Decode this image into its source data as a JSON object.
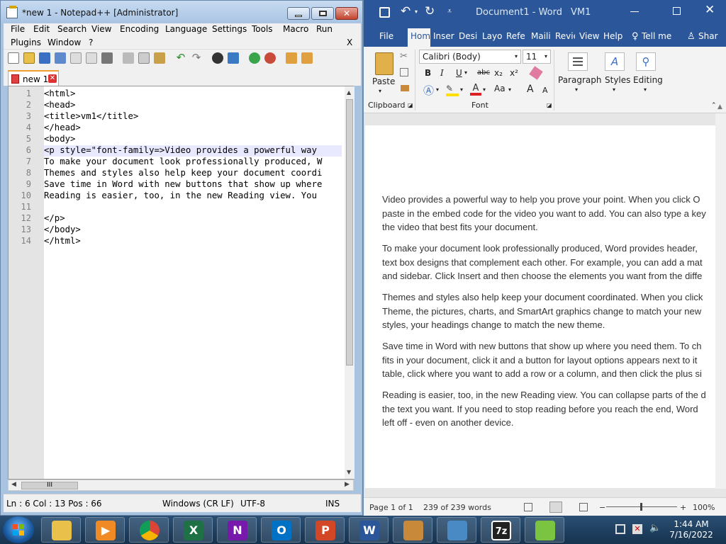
{
  "notepad": {
    "title": "*new 1 - Notepad++ [Administrator]",
    "menu": [
      "File",
      "Edit",
      "Search",
      "View",
      "Encoding",
      "Language",
      "Settings",
      "Tools",
      "Macro",
      "Run",
      "Plugins",
      "Window",
      "?"
    ],
    "menu_close": "X",
    "tab_label": "new 1",
    "lines": [
      {
        "n": "1",
        "text": "<html>"
      },
      {
        "n": "2",
        "text": "<head>"
      },
      {
        "n": "3",
        "text": "<title>vm1</title>"
      },
      {
        "n": "4",
        "text": "</head>"
      },
      {
        "n": "5",
        "text": "<body>"
      },
      {
        "n": "6",
        "text": "<p style=\"font-family=>Video provides a powerful way"
      },
      {
        "n": "7",
        "text": "To make your document look professionally produced, W"
      },
      {
        "n": "8",
        "text": "Themes and styles also help keep your document coordi"
      },
      {
        "n": "9",
        "text": "Save time in Word with new buttons that show up where"
      },
      {
        "n": "10",
        "text": "Reading is easier, too, in the new Reading view. You"
      },
      {
        "n": "11",
        "text": ""
      },
      {
        "n": "12",
        "text": "</p>"
      },
      {
        "n": "13",
        "text": "</body>"
      },
      {
        "n": "14",
        "text": "</html>"
      }
    ],
    "hscroll_thumb": "III",
    "status": {
      "pos": "Ln : 6    Col : 13    Pos : 66",
      "eol": "Windows (CR LF)",
      "enc": "UTF-8",
      "mode": "INS"
    }
  },
  "word": {
    "doc_title": "Document1  -  Word",
    "vm": "VM1",
    "tabs": [
      "File",
      "Hom",
      "Inser",
      "Desig",
      "Layo",
      "Refe",
      "Maili",
      "Revie",
      "View",
      "Help",
      "Tell me",
      "Shar"
    ],
    "font_name": "Calibri (Body)",
    "font_size": "11",
    "paste_label": "Paste",
    "clipboard_label": "Clipboard",
    "font_label": "Font",
    "paragraph_label": "Paragraph",
    "styles_label": "Styles",
    "editing_label": "Editing",
    "fmt": {
      "b": "B",
      "i": "I",
      "u": "U",
      "strike": "abc",
      "sub": "x₂",
      "sup": "x²",
      "case": "Aa",
      "grow": "A",
      "shrink": "A"
    },
    "paragraphs": [
      [
        "Video provides a powerful way to help you prove your point. When you click O",
        "paste in the embed code for the video you want to add. You can also type a key",
        "the video that best fits your document."
      ],
      [
        "To make your document look professionally produced, Word provides header,",
        "text box designs that complement each other. For example, you can add a mat",
        "and sidebar. Click Insert and then choose the elements you want from the diffe"
      ],
      [
        "Themes and styles also help keep your document coordinated. When you click",
        "Theme, the pictures, charts, and SmartArt graphics change to match your new",
        "styles, your headings change to match the new theme."
      ],
      [
        "Save time in Word with new buttons that show up where you need them. To ch",
        "fits in your document, click it and a button for layout options appears next to it",
        "table, click where you want to add a row or a column, and then click the plus si"
      ],
      [
        "Reading is easier, too, in the new Reading view. You can collapse parts of the d",
        "the text you want. If you need to stop reading before you reach the end, Word",
        "left off - even on another device."
      ]
    ],
    "status": {
      "page": "Page 1 of 1",
      "words": "239 of 239 words",
      "zoom": "100%",
      "minus": "−",
      "plus": "+"
    }
  },
  "taskbar": {
    "apps": [
      {
        "name": "file-explorer",
        "glyph": ""
      },
      {
        "name": "media-player",
        "glyph": "▶"
      },
      {
        "name": "chrome",
        "glyph": ""
      },
      {
        "name": "excel",
        "glyph": "X"
      },
      {
        "name": "onenote",
        "glyph": "N"
      },
      {
        "name": "outlook",
        "glyph": "O"
      },
      {
        "name": "powerpoint",
        "glyph": "P"
      },
      {
        "name": "word",
        "glyph": "W"
      },
      {
        "name": "toolbox",
        "glyph": ""
      },
      {
        "name": "control-panel",
        "glyph": ""
      },
      {
        "name": "7zip",
        "glyph": "7z"
      },
      {
        "name": "notepad-plus-plus",
        "glyph": ""
      }
    ],
    "time": "1:44 AM",
    "date": "7/16/2022"
  }
}
